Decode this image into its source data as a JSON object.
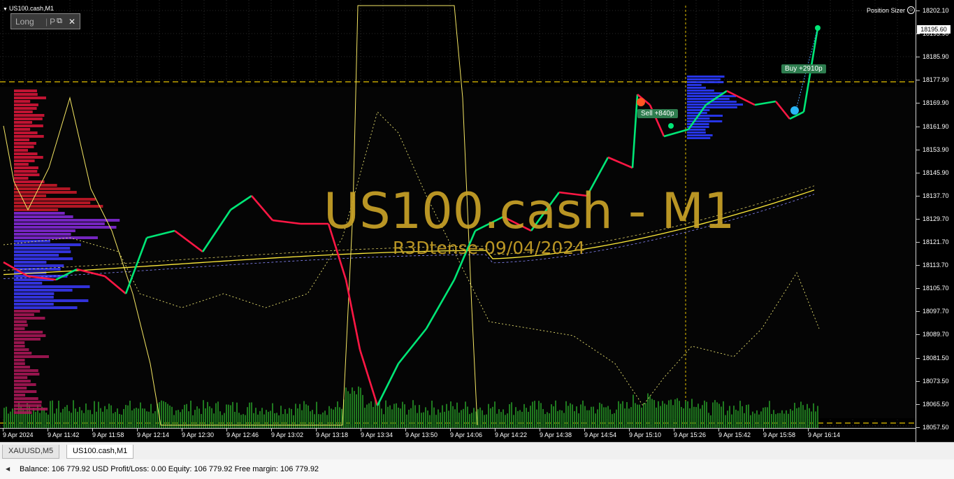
{
  "chart": {
    "symbol_label": "US100.cash,M1",
    "watermark_title": "US100.cash - M1",
    "watermark_subtitle": "R3Dtense-09/04/2024",
    "current_price": "18195.60",
    "price_ticks": [
      "18202.10",
      "18193.90",
      "18185.90",
      "18177.90",
      "18169.90",
      "18161.90",
      "18153.90",
      "18145.90",
      "18137.70",
      "18129.70",
      "18121.70",
      "18113.70",
      "18105.70",
      "18097.70",
      "18089.70",
      "18081.50",
      "18073.50",
      "18065.50",
      "18057.50"
    ],
    "time_ticks": [
      "9 Apr 2024",
      "9 Apr 11:42",
      "9 Apr 11:58",
      "9 Apr 12:14",
      "9 Apr 12:30",
      "9 Apr 12:46",
      "9 Apr 13:02",
      "9 Apr 13:18",
      "9 Apr 13:34",
      "9 Apr 13:50",
      "9 Apr 14:06",
      "9 Apr 14:22",
      "9 Apr 14:38",
      "9 Apr 14:54",
      "9 Apr 15:10",
      "9 Apr 15:26",
      "9 Apr 15:42",
      "9 Apr 15:58",
      "9 Apr 16:14"
    ],
    "trade_labels": {
      "sell": "Sell +840p",
      "buy": "Buy +2910p"
    },
    "colors": {
      "background": "#000000",
      "bull": "#00e676",
      "bear": "#ff1744",
      "ma": "#ffeb3b",
      "level": "#e6c200",
      "volume": "#1f7a1f",
      "watermark": "#c9a227"
    }
  },
  "trade_panel": {
    "direction": "Long",
    "mode": "P",
    "close": "✕"
  },
  "position_sizer": {
    "label": "Position Sizer"
  },
  "tabs": [
    {
      "label": "XAUUSD,M5",
      "active": false
    },
    {
      "label": "US100.cash,M1",
      "active": true
    }
  ],
  "status": {
    "text": "Balance: 106 779.92 USD  Profit/Loss: 0.00  Equity: 106 779.92  Free margin: 106 779.92"
  }
}
